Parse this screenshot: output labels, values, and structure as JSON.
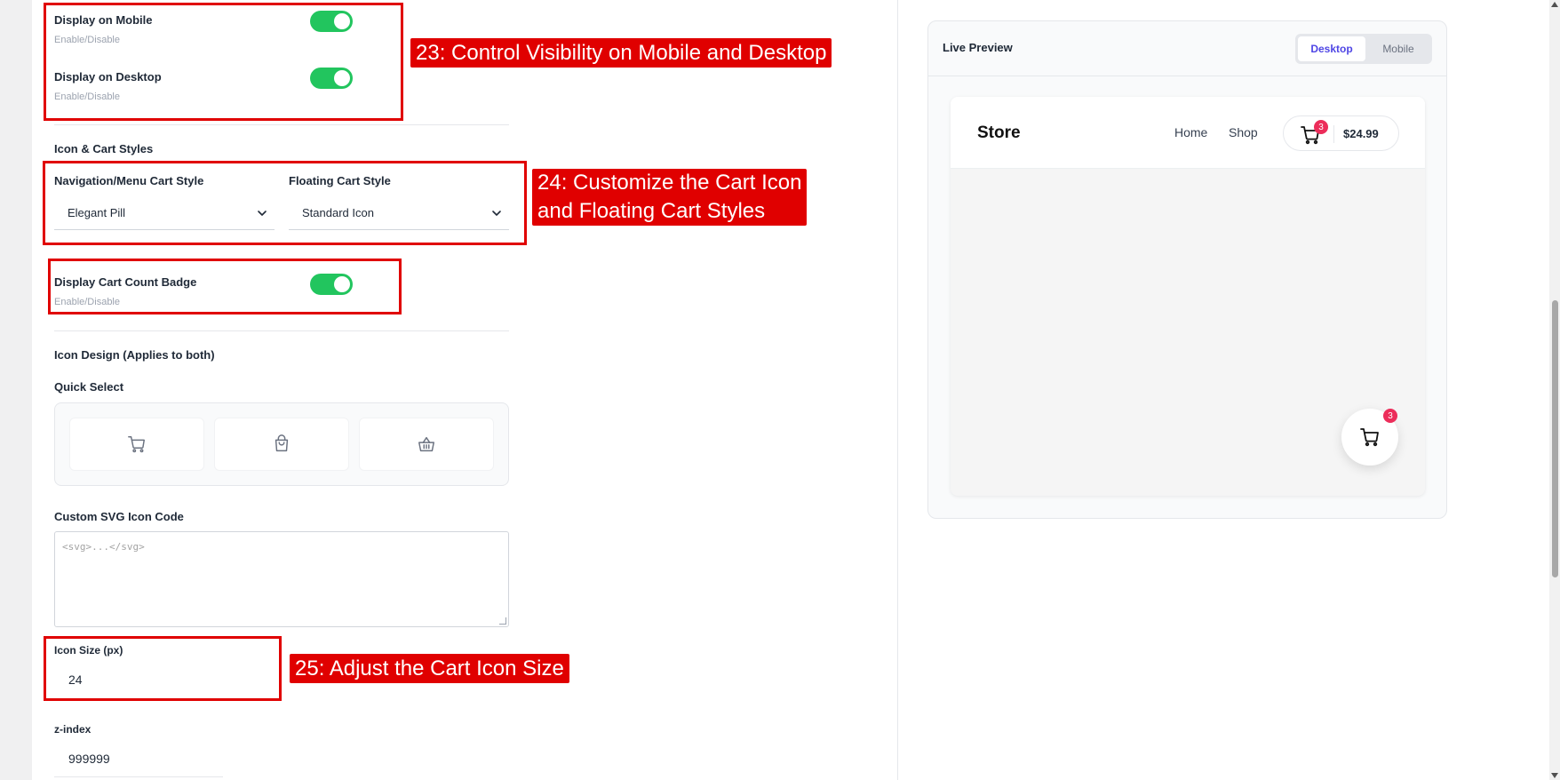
{
  "visibility": {
    "mobile_label": "Display on Mobile",
    "mobile_sub": "Enable/Disable",
    "desktop_label": "Display on Desktop",
    "desktop_sub": "Enable/Disable"
  },
  "icon_cart_styles": {
    "title": "Icon & Cart Styles",
    "nav_label": "Navigation/Menu Cart Style",
    "nav_value": "Elegant Pill",
    "floating_label": "Floating Cart Style",
    "floating_value": "Standard Icon"
  },
  "badge_setting": {
    "label": "Display Cart Count Badge",
    "sub": "Enable/Disable"
  },
  "icon_design": {
    "title": "Icon Design (Applies to both)",
    "quick_select_label": "Quick Select",
    "quick_options": [
      "cart-icon",
      "bag-icon",
      "basket-icon"
    ],
    "custom_svg_label": "Custom SVG Icon Code",
    "custom_svg_placeholder": "<svg>...</svg>"
  },
  "icon_size": {
    "label": "Icon Size (px)",
    "value": "24"
  },
  "zindex": {
    "label": "z-index",
    "value": "999999"
  },
  "annotations": {
    "a23": "23: Control Visibility on Mobile and Desktop",
    "a24_line1": "24: Customize the Cart Icon",
    "a24_line2": "and Floating Cart Styles",
    "a25": "25: Adjust the Cart Icon Size"
  },
  "preview": {
    "title": "Live Preview",
    "tab_desktop": "Desktop",
    "tab_mobile": "Mobile",
    "store_name": "Store",
    "nav_home": "Home",
    "nav_shop": "Shop",
    "cart_count": "3",
    "cart_total": "$24.99",
    "floating_count": "3"
  },
  "colors": {
    "toggle_on": "#22c55e",
    "annotation_red": "#e00000",
    "badge": "#ec2d5a",
    "accent": "#4f46e5"
  }
}
